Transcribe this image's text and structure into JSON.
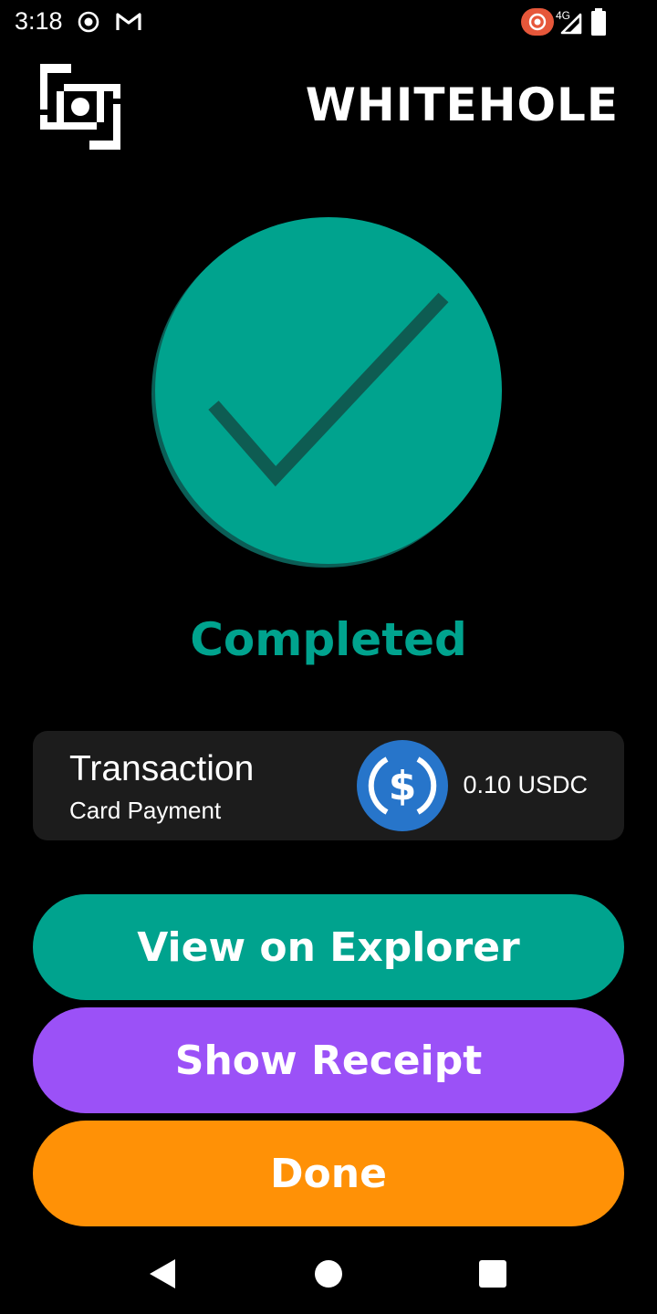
{
  "status_bar": {
    "time": "3:18",
    "network": "4G",
    "icons": [
      "record-icon",
      "gmail-icon",
      "cast-recording-icon",
      "signal-icon",
      "battery-icon"
    ]
  },
  "header": {
    "app_name": "WHITEHOLE",
    "logo_icon": "whitehole-logo-icon"
  },
  "result": {
    "icon": "checkmark-circle-icon",
    "status": "Completed",
    "colors": {
      "primary": "#00A38E",
      "shadow": "#0B5E56",
      "check": "#0E5C52"
    }
  },
  "transaction": {
    "title": "Transaction",
    "type": "Card Payment",
    "token_icon": "usdc-icon",
    "amount": "0.10 USDC"
  },
  "actions": {
    "explorer_label": "View on Explorer",
    "receipt_label": "Show Receipt",
    "done_label": "Done",
    "colors": {
      "explorer": "#00A38E",
      "receipt": "#9B51F7",
      "done": "#FF9106"
    }
  },
  "nav_bar": {
    "icons": [
      "back-icon",
      "home-icon",
      "recents-icon"
    ]
  }
}
